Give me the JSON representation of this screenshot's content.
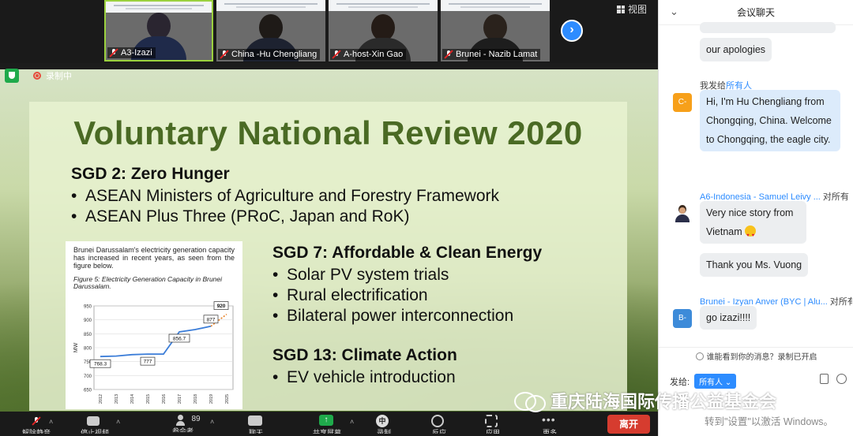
{
  "gallery": {
    "participants": [
      {
        "name": "A3-Izazi",
        "head": "#2a2530",
        "body": "#1f2a4a"
      },
      {
        "name": "China -Hu Chengliang",
        "head": "#1e1a17",
        "body": "#1d2230"
      },
      {
        "name": "A-host-Xin Gao",
        "head": "#241b16",
        "body": "#2a2a2a"
      },
      {
        "name": "Brunei - Nazib Lamat",
        "head": "#2a221c",
        "body": "#1d1d1d"
      }
    ],
    "view_label": "视图"
  },
  "share_bar": {
    "recording_label": "录制中"
  },
  "slide": {
    "title": "Voluntary National Review 2020",
    "sections": [
      {
        "heading": "SGD 2: Zero Hunger",
        "items": [
          "ASEAN Ministers of Agriculture and Forestry Framework",
          "ASEAN Plus Three (PRoC, Japan and RoK)"
        ]
      },
      {
        "heading": "SGD 7: Affordable & Clean Energy",
        "items": [
          "Solar PV system trials",
          "Rural electrification",
          "Bilateral power interconnection"
        ]
      },
      {
        "heading": "SGD 13: Climate Action",
        "items": [
          "EV vehicle introduction"
        ]
      }
    ],
    "report_text": "Brunei Darussalam's electricity generation capacity has increased in recent years, as seen from the figure below.",
    "figure_caption": "Figure 5: Electricity Generation Capacity in Brunei Darussalam."
  },
  "chart_data": {
    "type": "line",
    "ylabel": "MW",
    "ylim": [
      650,
      950
    ],
    "yticks": [
      650,
      700,
      750,
      800,
      850,
      900,
      950
    ],
    "x": [
      "2012",
      "2013",
      "2014",
      "2015",
      "2016",
      "2017",
      "2018",
      "2019",
      "2025"
    ],
    "series": [
      {
        "values": [
          768.3,
          770,
          775,
          777,
          777,
          856.7,
          865,
          877,
          920
        ]
      }
    ],
    "labels": [
      {
        "x": "2012",
        "value": "768.3"
      },
      {
        "x": "2015",
        "value": "777"
      },
      {
        "x": "2017",
        "value": "856.7"
      },
      {
        "x": "2019",
        "value": "877"
      },
      {
        "x": "2025",
        "value": "920"
      }
    ]
  },
  "toolbar": {
    "items": [
      "解除静音",
      "停止视频",
      "参会者",
      "聊天",
      "共享屏幕",
      "录制",
      "反应",
      "应用",
      "更多"
    ],
    "participant_count": "89",
    "zhong_glyph": "中",
    "leave_label": "离开"
  },
  "chat": {
    "title": "会议聊天",
    "messages": [
      {
        "text": "our apologies"
      },
      {
        "sender_label": "我发给",
        "to": "所有人",
        "avatar": "C-",
        "text": "Hi, I'm Hu Chengliang from Chongqing, China. Welcome to Chongqing, the eagle  city."
      },
      {
        "sender": "A6-Indonesia - Samuel Leivy ...",
        "to": "对所有",
        "text": "Very nice story from Vietnam"
      },
      {
        "text": "Thank you Ms. Vuong"
      },
      {
        "sender": "Brunei - Izyan Anver (BYC | Alu...",
        "to": "对所有",
        "avatar": "B-",
        "text": "go izazi!!!!"
      }
    ],
    "privacy_note": "谁能看到你的消息？录制已开启",
    "send_to_label": "发给:",
    "send_to_value": "所有人"
  },
  "overlay": {
    "watermark": "重庆陆海国际传播公益基金会",
    "activation": "转到\"设置\"以激活 Windows。"
  },
  "colors": {
    "accent": "#2d8cff",
    "leave": "#d63c2f",
    "title_green": "#4a6a24"
  }
}
